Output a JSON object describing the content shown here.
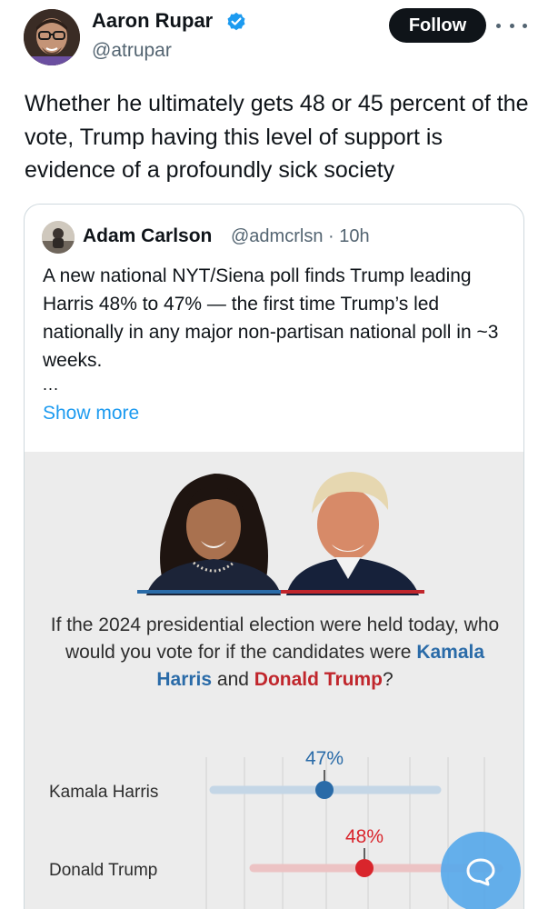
{
  "header": {
    "display_name": "Aaron Rupar",
    "handle": "@atrupar",
    "follow_label": "Follow",
    "verified_color": "#1d9bf0"
  },
  "tweet": {
    "text": "Whether he ultimately gets 48 or 45 percent of the vote, Trump having this level of support is evidence of a profoundly sick society"
  },
  "quoted_tweet": {
    "display_name": "Adam Carlson",
    "handle_time": "@admcrlsn · 10h",
    "text": "A new national NYT/Siena poll finds Trump leading Harris 48% to 47% — the first time Trump’s led nationally in any major non-partisan national poll in ~3 weeks.",
    "ellipsis": "...",
    "show_more_label": "Show more"
  },
  "poll_graphic": {
    "question_prefix": "If the 2024 presidential election were held today, who would you vote for if the candidates were ",
    "harris_name": "Kamala Harris",
    "question_and": " and ",
    "trump_name": "Donald Trump",
    "question_suffix": "?",
    "harris_color": "#2a6ba8",
    "trump_color": "#c0262c"
  },
  "chart_data": {
    "type": "scatter",
    "rows": [
      {
        "name": "Kamala Harris",
        "value": 47,
        "label": "47%",
        "color": "#2a6ba8",
        "range_color": "#c4d6e6"
      },
      {
        "name": "Donald Trump",
        "value": 48,
        "label": "48%",
        "color": "#d9252c",
        "range_color": "#ecc3c4"
      }
    ]
  },
  "icons": {
    "more": "more-horizontal-icon",
    "verified": "verified-badge-icon",
    "compose": "speech-bubble-icon"
  }
}
